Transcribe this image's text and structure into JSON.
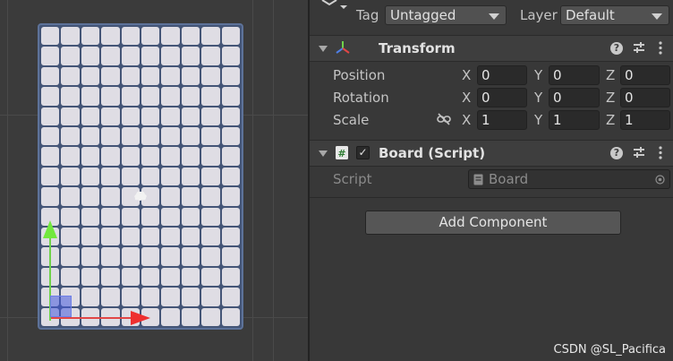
{
  "scene": {
    "board_columns": 10,
    "board_rows": 15
  },
  "inspector": {
    "tag_label": "Tag",
    "tag_value": "Untagged",
    "layer_label": "Layer",
    "layer_value": "Default",
    "transform": {
      "title": "Transform",
      "rows": [
        {
          "label": "Position",
          "x": "0",
          "y": "0",
          "z": "0"
        },
        {
          "label": "Rotation",
          "x": "0",
          "y": "0",
          "z": "0"
        },
        {
          "label": "Scale",
          "x": "1",
          "y": "1",
          "z": "1"
        }
      ],
      "axis_x": "X",
      "axis_y": "Y",
      "axis_z": "Z"
    },
    "board_script": {
      "title": "Board (Script)",
      "enabled_mark": "✓",
      "script_label": "Script",
      "script_value": "Board"
    },
    "add_component_label": "Add Component"
  },
  "watermark": "CSDN @SL_Pacifica",
  "colors": {
    "gizmo_x": "#e14646",
    "gizmo_y": "#6fd24a",
    "board_bg": "#445577",
    "cell": "#dfdde4"
  }
}
